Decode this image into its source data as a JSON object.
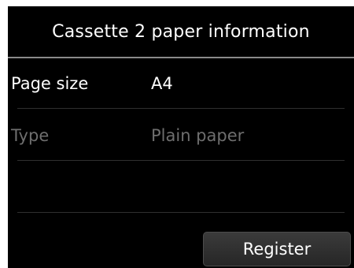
{
  "header": {
    "title": "Cassette 2 paper information"
  },
  "settings": {
    "rows": [
      {
        "label": "Page size",
        "value": "A4",
        "enabled": true
      },
      {
        "label": "Type",
        "value": "Plain paper",
        "enabled": false
      }
    ]
  },
  "actions": {
    "register_label": "Register"
  },
  "colors": {
    "background": "#000000",
    "text_enabled": "#ffffff",
    "text_disabled": "#6e6e6e",
    "divider": "#8a8a8a"
  }
}
